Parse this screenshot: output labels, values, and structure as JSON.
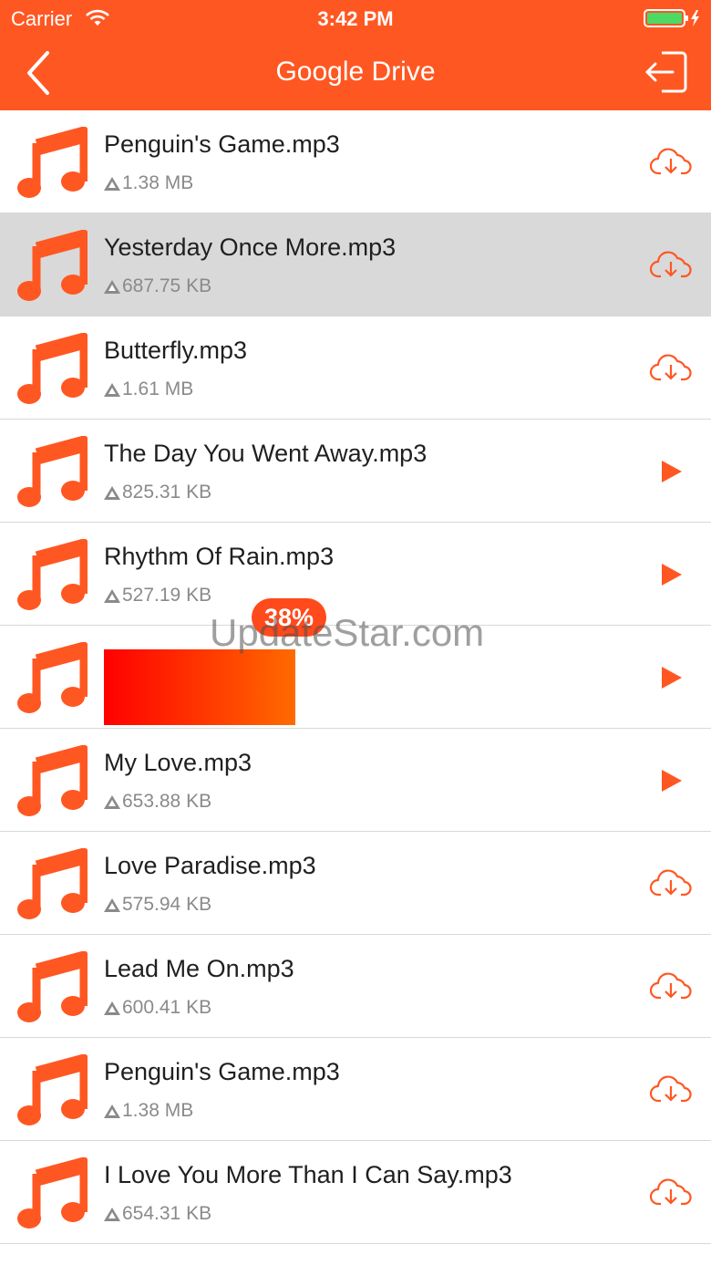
{
  "status": {
    "carrier": "Carrier",
    "time": "3:42 PM"
  },
  "nav": {
    "title": "Google Drive"
  },
  "colors": {
    "accent": "#ff5722",
    "selected_row": "#d9d9d9",
    "separator": "#d8d8d8"
  },
  "icons": {
    "file": "music-note-icon",
    "download": "cloud-download-icon",
    "play": "play-icon",
    "size": "drive-icon"
  },
  "files": [
    {
      "name": "Penguin's Game.mp3",
      "size": "1.38 MB",
      "action": "download"
    },
    {
      "name": "Yesterday Once More.mp3",
      "size": "687.75 KB",
      "action": "download",
      "selected": true
    },
    {
      "name": "Butterfly.mp3",
      "size": "1.61 MB",
      "action": "download"
    },
    {
      "name": "The Day You Went Away.mp3",
      "size": "825.31 KB",
      "action": "play"
    },
    {
      "name": "Rhythm Of Rain.mp3",
      "size": "527.19 KB",
      "action": "play"
    },
    {
      "name": "",
      "size": "",
      "action": "play",
      "downloading": true,
      "progress_label": "38%",
      "progress": 0.38
    },
    {
      "name": "My Love.mp3",
      "size": "653.88 KB",
      "action": "play"
    },
    {
      "name": "Love Paradise.mp3",
      "size": "575.94 KB",
      "action": "download"
    },
    {
      "name": "Lead Me On.mp3",
      "size": "600.41 KB",
      "action": "download"
    },
    {
      "name": "Penguin's Game.mp3",
      "size": "1.38 MB",
      "action": "download"
    },
    {
      "name": "I Love You More Than I Can Say.mp3",
      "size": "654.31 KB",
      "action": "download"
    }
  ],
  "watermark": "UpdateStar.com"
}
